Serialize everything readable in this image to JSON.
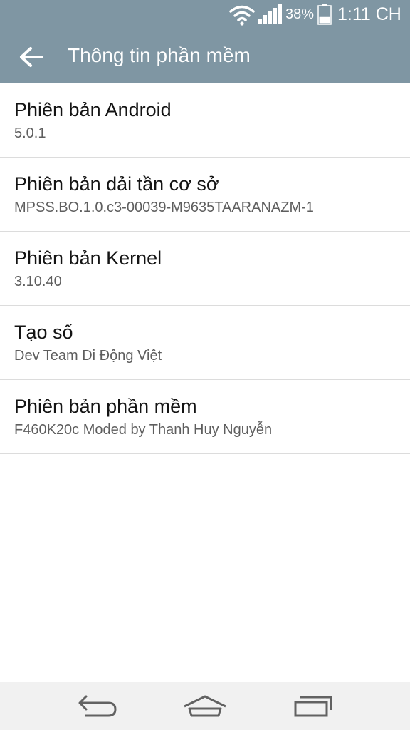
{
  "status_bar": {
    "battery_percent": "38%",
    "battery_level": 0.38,
    "time": "1:11 CH",
    "icons": [
      "wifi-icon",
      "signal-icon",
      "battery-icon"
    ]
  },
  "header": {
    "title": "Thông tin phần mềm",
    "back_icon": "arrow-left-icon"
  },
  "items": [
    {
      "title": "Phiên bản Android",
      "value": "5.0.1"
    },
    {
      "title": "Phiên bản dải tần cơ sở",
      "value": "MPSS.BO.1.0.c3-00039-M9635TAARANAZM-1"
    },
    {
      "title": "Phiên bản Kernel",
      "value": "3.10.40"
    },
    {
      "title": "Tạo số",
      "value": "Dev Team Di Động Việt"
    },
    {
      "title": "Phiên bản phần mềm",
      "value": "F460K20c Moded by Thanh Huy Nguyễn"
    }
  ],
  "nav_bar": {
    "icons": [
      "back-icon",
      "home-icon",
      "recent-apps-icon"
    ]
  },
  "colors": {
    "header_bg": "#7f96a3",
    "nav_bg": "#f1f1f1",
    "divider": "#dcdcdc",
    "title_text": "#141414",
    "subtitle_text": "#5e5e5e"
  }
}
